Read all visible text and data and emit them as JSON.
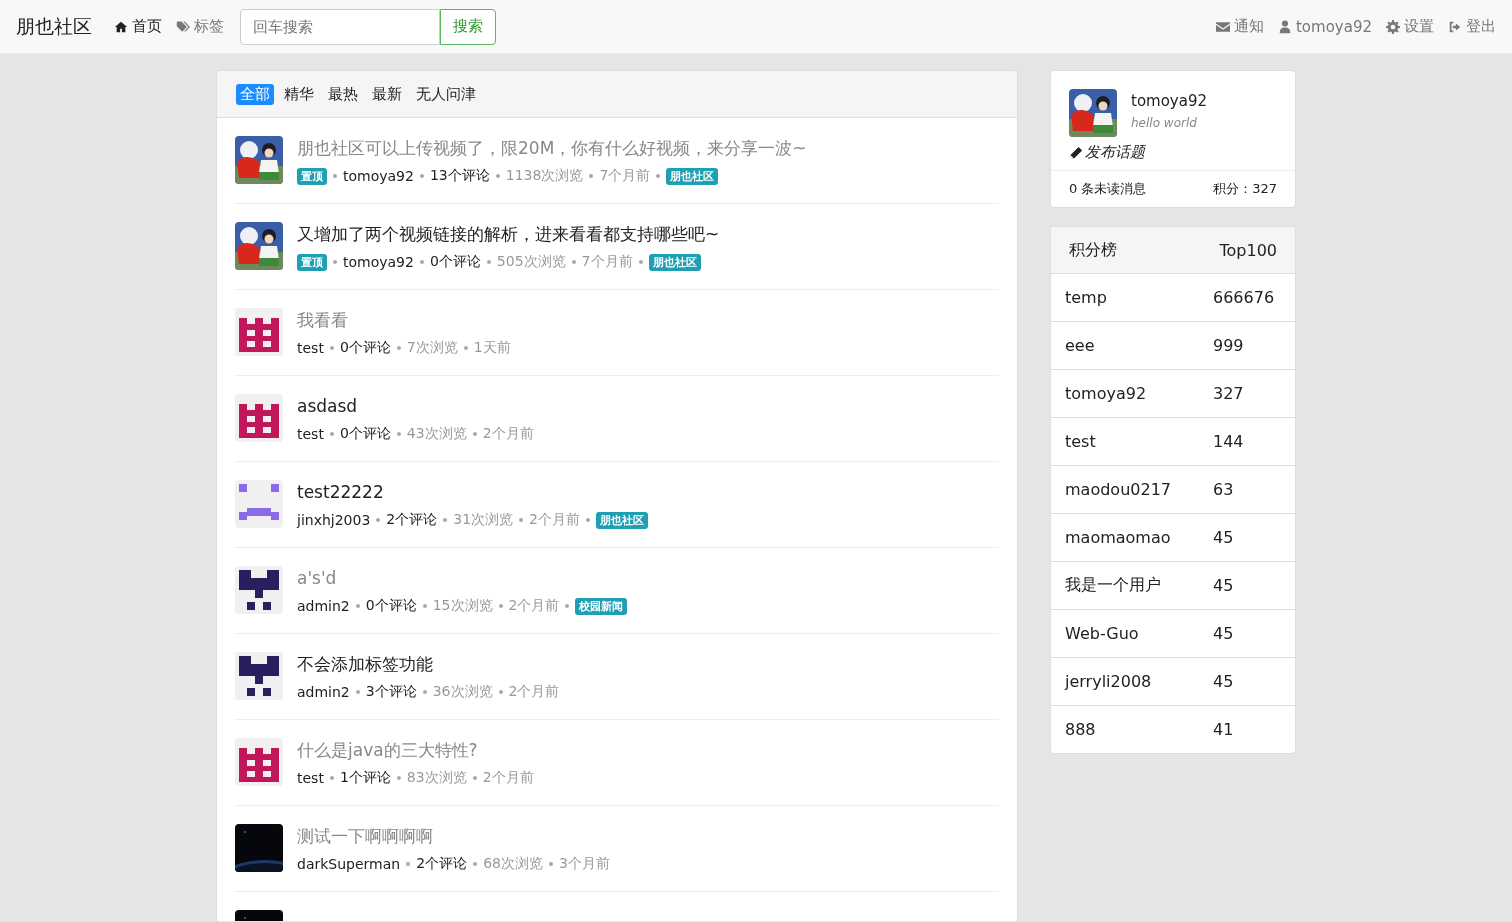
{
  "navbar": {
    "brand": "朋也社区",
    "links": [
      {
        "label": "首页",
        "selected": true
      },
      {
        "label": "标签",
        "selected": false
      }
    ],
    "search": {
      "placeholder": "回车搜索",
      "button": "搜索"
    },
    "right_links": [
      {
        "label": "通知"
      },
      {
        "label": "tomoya92"
      },
      {
        "label": "设置"
      },
      {
        "label": "登出"
      }
    ]
  },
  "tabs": [
    {
      "label": "全部",
      "selected": true
    },
    {
      "label": "精华",
      "selected": false
    },
    {
      "label": "最热",
      "selected": false
    },
    {
      "label": "最新",
      "selected": false
    },
    {
      "label": "无人问津",
      "selected": false
    }
  ],
  "topics": [
    {
      "avatar": {
        "kind": "anime"
      },
      "title": "朋也社区可以上传视频了，限20M，你有什么好视频，来分享一波~",
      "visited": true,
      "pin_label": "置顶",
      "author": "tomoya92",
      "comments": "13个评论",
      "views": "1138次浏览",
      "time": "7个月前",
      "tag": "朋也社区"
    },
    {
      "avatar": {
        "kind": "anime"
      },
      "title": "又增加了两个视频链接的解析，进来看看都支持哪些吧~",
      "visited": false,
      "pin_label": "置顶",
      "author": "tomoya92",
      "comments": "0个评论",
      "views": "505次浏览",
      "time": "7个月前",
      "tag": "朋也社区"
    },
    {
      "avatar": {
        "kind": "castle",
        "color": "#c2185b"
      },
      "title": "我看看",
      "visited": true,
      "author": "test",
      "comments": "0个评论",
      "views": "7次浏览",
      "time": "1天前"
    },
    {
      "avatar": {
        "kind": "castle",
        "color": "#c2185b"
      },
      "title": "asdasd",
      "visited": false,
      "author": "test",
      "comments": "0个评论",
      "views": "43次浏览",
      "time": "2个月前"
    },
    {
      "avatar": {
        "kind": "face",
        "color": "#8a6be6"
      },
      "title": "test22222",
      "visited": false,
      "author": "jinxhj2003",
      "comments": "2个评论",
      "views": "31次浏览",
      "time": "2个月前",
      "tag": "朋也社区"
    },
    {
      "avatar": {
        "kind": "figure",
        "color": "#2a1f5e"
      },
      "title": "a's'd",
      "visited": true,
      "author": "admin2",
      "comments": "0个评论",
      "views": "15次浏览",
      "time": "2个月前",
      "tag": "校园新闻"
    },
    {
      "avatar": {
        "kind": "figure",
        "color": "#2a1f5e"
      },
      "title": "不会添加标签功能",
      "visited": false,
      "author": "admin2",
      "comments": "3个评论",
      "views": "36次浏览",
      "time": "2个月前"
    },
    {
      "avatar": {
        "kind": "castle",
        "color": "#c2185b"
      },
      "title": "什么是java的三大特性?",
      "visited": true,
      "author": "test",
      "comments": "1个评论",
      "views": "83次浏览",
      "time": "2个月前"
    },
    {
      "avatar": {
        "kind": "space"
      },
      "title": "测试一下啊啊啊啊",
      "visited": true,
      "author": "darkSuperman",
      "comments": "2个评论",
      "views": "68次浏览",
      "time": "3个月前"
    },
    {
      "avatar": {
        "kind": "space"
      }
    }
  ],
  "profile": {
    "avatar": {
      "kind": "anime"
    },
    "username": "tomoya92",
    "signature": "hello world",
    "new_topic": "发布话题",
    "unread": "0 条未读消息",
    "score": "积分：327"
  },
  "leaderboard": {
    "title": "积分榜",
    "link": "Top100",
    "rows": [
      {
        "name": "temp",
        "score": "666676"
      },
      {
        "name": "eee",
        "score": "999"
      },
      {
        "name": "tomoya92",
        "score": "327"
      },
      {
        "name": "test",
        "score": "144"
      },
      {
        "name": "maodou0217",
        "score": "63"
      },
      {
        "name": "maomaomao",
        "score": "45"
      },
      {
        "name": "我是一个用户",
        "score": "45"
      },
      {
        "name": "Web-Guo",
        "score": "45"
      },
      {
        "name": "jerryli2008",
        "score": "45"
      },
      {
        "name": "888",
        "score": "41"
      }
    ]
  }
}
